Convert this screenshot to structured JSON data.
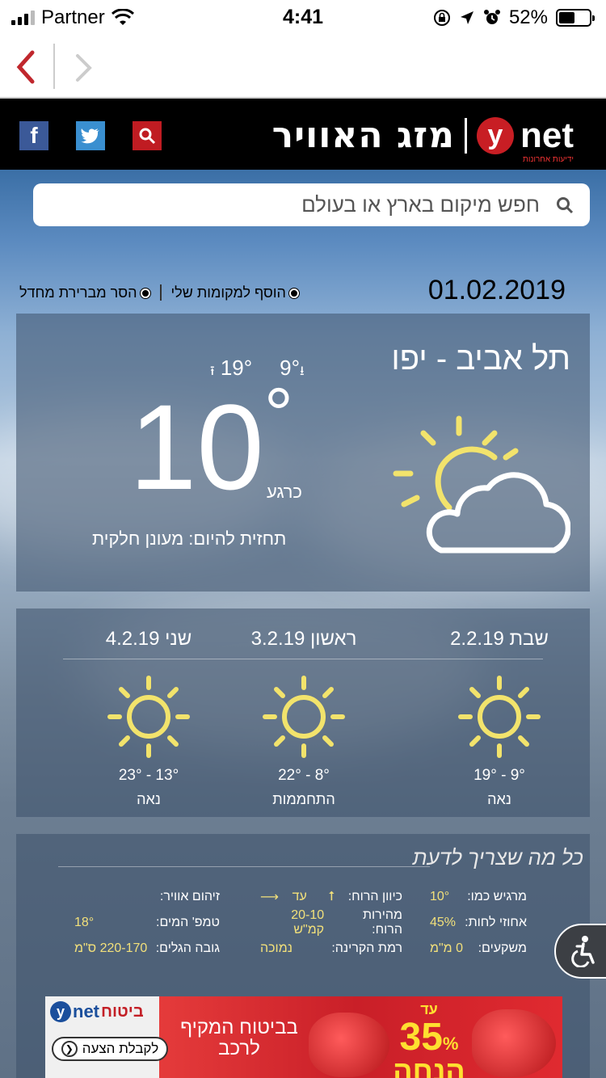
{
  "status_bar": {
    "carrier": "Partner",
    "time": "4:41",
    "battery": "52%",
    "battery_level": 0.52
  },
  "header": {
    "title": "מזג האוויר",
    "logo_letter": "y",
    "logo_word": "net",
    "logo_tagline": "ידיעות אחרונות"
  },
  "search": {
    "placeholder": "חפש מיקום בארץ או בעולם"
  },
  "links": {
    "add_location": "הוסף למקומות שלי",
    "remove_default": "הסר מברירת מחדל"
  },
  "current": {
    "date": "01.02.2019",
    "city": "תל אביב - יפו",
    "high": "19°",
    "low": "9°",
    "temp": "10",
    "degree": "°",
    "now_label": "כרגע",
    "forecast_label": "תחזית להיום: מעונן חלקית",
    "icon": "partly-cloudy-icon"
  },
  "forecast": [
    {
      "name": "שבת 2.2.19",
      "range": "19° - 9°",
      "desc": "נאה",
      "icon": "sun-icon"
    },
    {
      "name": "ראשון 3.2.19",
      "range": "22° - 8°",
      "desc": "התחממות",
      "icon": "sun-icon"
    },
    {
      "name": "שני 4.2.19",
      "range": "23° - 13°",
      "desc": "נאה",
      "icon": "sun-icon"
    }
  ],
  "details": {
    "heading": "כל מה שצריך לדעת",
    "rows": [
      [
        {
          "k": "מרגיש כמו:",
          "v": "10°"
        },
        {
          "k": "כיוון הרוח:",
          "v": "עד"
        },
        {
          "k": "זיהום אוויר:",
          "v": ""
        }
      ],
      [
        {
          "k": "אחוזי לחות:",
          "v": "45%"
        },
        {
          "k": "מהירות הרוח:",
          "v": "20-10 קמ\"ש"
        },
        {
          "k": "טמפ' המים:",
          "v": "18°"
        }
      ],
      [
        {
          "k": "משקעים:",
          "v": "0 מ\"מ"
        },
        {
          "k": "רמת הקרינה:",
          "v": "נמוכה"
        },
        {
          "k": "גובה הגלים:",
          "v": "220-170 ס\"מ"
        }
      ]
    ]
  },
  "ad": {
    "brand": "ביטוח",
    "brand_logo_letter": "y",
    "brand_logo_word": "net",
    "cta": "לקבלת הצעה",
    "message": "בביטוח המקיף לרכב",
    "upto": "עד",
    "number": "35",
    "percent": "%",
    "discount": "הנחה"
  }
}
